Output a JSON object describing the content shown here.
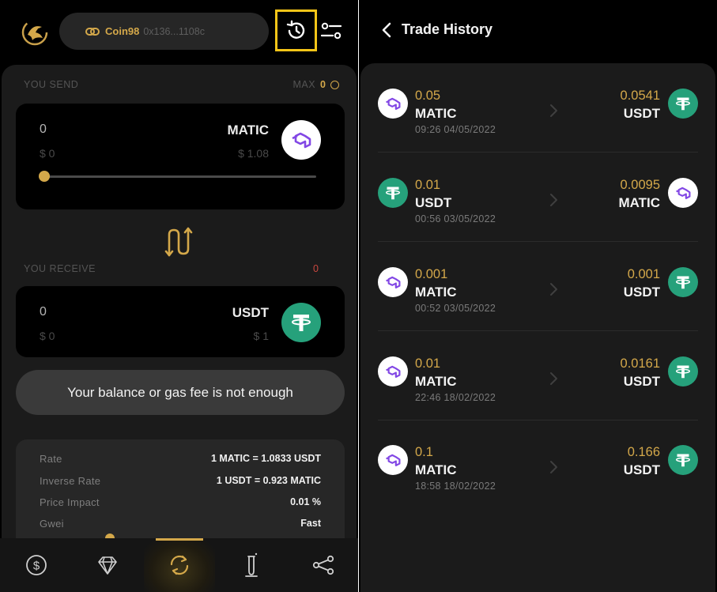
{
  "left_panel": {
    "header": {
      "wallet_name": "Coin98",
      "wallet_address": "0x136...1108c"
    },
    "send": {
      "label": "YOU SEND",
      "max_label": "MAX",
      "max_value": "0",
      "amount": "0",
      "amount_usd": "$ 0",
      "token_symbol": "MATIC",
      "token_price_usd": "$ 1.08",
      "token_icon": "matic-icon",
      "slider_percent": 0
    },
    "receive": {
      "label": "YOU RECEIVE",
      "value": "0",
      "amount": "0",
      "amount_usd": "$ 0",
      "token_symbol": "USDT",
      "token_price_usd": "$ 1",
      "token_icon": "usdt-icon"
    },
    "warning_button": "Your balance or gas fee is not enough",
    "info": {
      "rate_label": "Rate",
      "rate_value": "1 MATIC = 1.0833 USDT",
      "inverse_label": "Inverse Rate",
      "inverse_value": "1 USDT = 0.923 MATIC",
      "impact_label": "Price Impact",
      "impact_value": "0.01 %",
      "gwei_label": "Gwei",
      "gwei_value": "Fast"
    },
    "bottom_nav": [
      "dollar-icon",
      "diamond-icon",
      "swap-icon",
      "flask-icon",
      "share-icon"
    ]
  },
  "right_panel": {
    "title": "Trade History",
    "trades": [
      {
        "from_amount": "0.05",
        "from_symbol": "MATIC",
        "time": "09:26 04/05/2022",
        "to_amount": "0.0541",
        "to_symbol": "USDT",
        "from_icon": "matic-icon",
        "to_icon": "usdt-icon"
      },
      {
        "from_amount": "0.01",
        "from_symbol": "USDT",
        "time": "00:56 03/05/2022",
        "to_amount": "0.0095",
        "to_symbol": "MATIC",
        "from_icon": "usdt-icon",
        "to_icon": "matic-icon"
      },
      {
        "from_amount": "0.001",
        "from_symbol": "MATIC",
        "time": "00:52 03/05/2022",
        "to_amount": "0.001",
        "to_symbol": "USDT",
        "from_icon": "matic-icon",
        "to_icon": "usdt-icon"
      },
      {
        "from_amount": "0.01",
        "from_symbol": "MATIC",
        "time": "22:46 18/02/2022",
        "to_amount": "0.0161",
        "to_symbol": "USDT",
        "from_icon": "matic-icon",
        "to_icon": "usdt-icon"
      },
      {
        "from_amount": "0.1",
        "from_symbol": "MATIC",
        "time": "18:58 18/02/2022",
        "to_amount": "0.166",
        "to_symbol": "USDT",
        "from_icon": "matic-icon",
        "to_icon": "usdt-icon"
      }
    ]
  },
  "colors": {
    "accent_gold": "#d4a84a",
    "highlight_yellow": "#f5c518",
    "usdt_green": "#26a17b",
    "matic_purple": "#8247e5",
    "error_red": "#c9473f"
  }
}
